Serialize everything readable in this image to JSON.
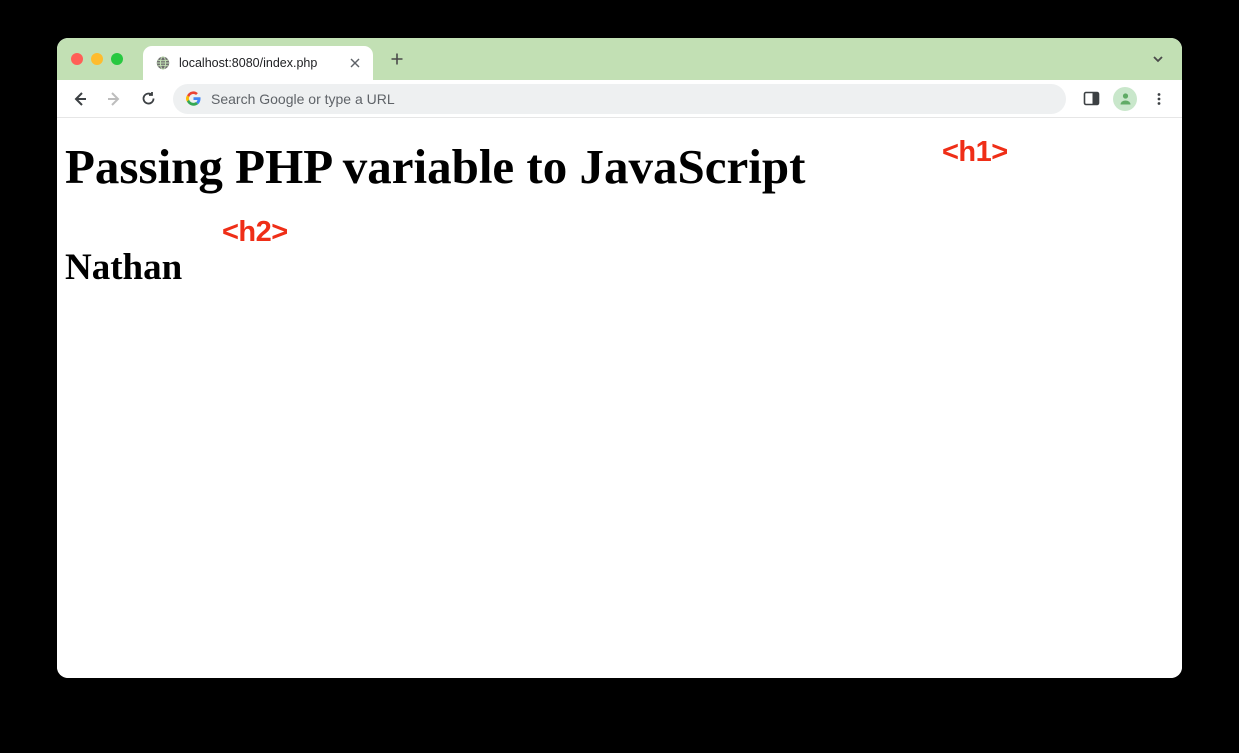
{
  "browser": {
    "tab": {
      "title": "localhost:8080/index.php"
    },
    "omnibox": {
      "placeholder": "Search Google or type a URL"
    }
  },
  "page": {
    "h1_text": "Passing PHP variable to JavaScript",
    "h2_text": "Nathan"
  },
  "annotations": {
    "h1_label": "<h1>",
    "h2_label": "<h2>"
  }
}
